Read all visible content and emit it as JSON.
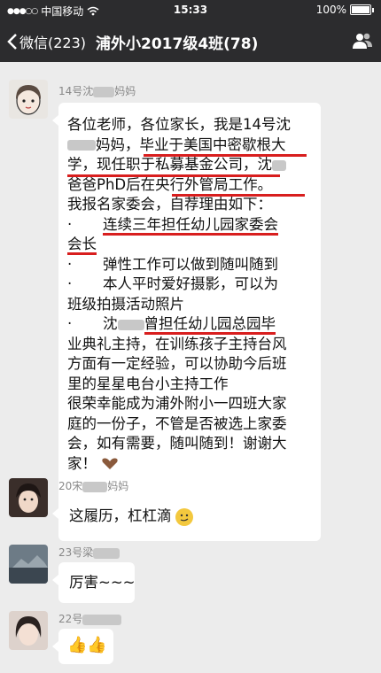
{
  "status": {
    "carrier": "中国移动",
    "time": "15:33",
    "battery": "100%"
  },
  "nav": {
    "back_label": "微信(223)",
    "title": "浦外小2017级4班(78)"
  },
  "messages": [
    {
      "sender_prefix": "14号沈",
      "sender_suffix": "妈妈",
      "lines": [
        "各位老师，各位家长，我是14号沈",
        "妈妈，毕业于美国中密歇根大",
        "学，现任职于私募基金公司，沈",
        "爸爸PhD后在央行外管局工作。",
        "我报名家委会，自荐理由如下：",
        "连续三年担任幼儿园家委会",
        "会长",
        "弹性工作可以做到随叫随到",
        "本人平时爱好摄影，可以为",
        "班级拍摄活动照片",
        "沈",
        "曾担任幼儿园总园毕",
        "业典礼主持，在训练孩子主持台风",
        "方面有一定经验，可以协助今后班",
        "里的星星电台小主持工作",
        "很荣幸能成为浦外附小一四班大家",
        "庭的一份子，不管是否被选上家委",
        "会，如有需要，随叫随到！谢谢大",
        "家！"
      ]
    },
    {
      "sender_prefix": "20宋",
      "sender_suffix": "妈妈",
      "text": "这履历，杠杠滴"
    },
    {
      "sender_prefix": "23号梁",
      "sender_suffix": "",
      "text": "厉害~~~"
    },
    {
      "sender_prefix": "22号",
      "sender_suffix": "",
      "text": "👍👍"
    }
  ]
}
